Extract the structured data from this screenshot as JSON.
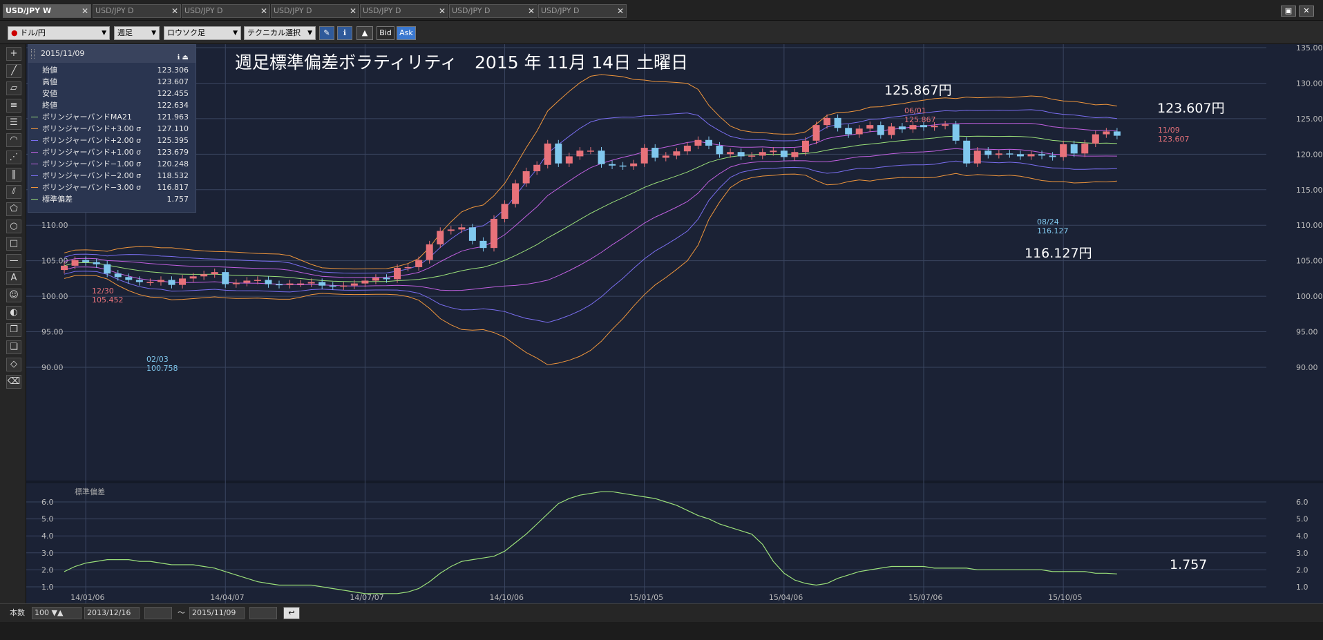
{
  "tabs": [
    {
      "label": "USD/JPY W",
      "active": true
    },
    {
      "label": "USD/JPY D"
    },
    {
      "label": "USD/JPY D"
    },
    {
      "label": "USD/JPY D"
    },
    {
      "label": "USD/JPY D"
    },
    {
      "label": "USD/JPY D"
    },
    {
      "label": "USD/JPY D"
    }
  ],
  "toolbar": {
    "currency": "ドル/円",
    "period": "週足",
    "chart_type": "ロウソク足",
    "technical": "テクニカル選択",
    "bid": "Bid",
    "ask": "Ask"
  },
  "legend": {
    "date": "2015/11/09",
    "rows": [
      {
        "label": "始値",
        "value": "123.306",
        "color": ""
      },
      {
        "label": "高値",
        "value": "123.607",
        "color": ""
      },
      {
        "label": "安値",
        "value": "122.455",
        "color": ""
      },
      {
        "label": "終値",
        "value": "122.634",
        "color": ""
      },
      {
        "label": "ボリンジャーバンドMA21",
        "value": "121.963",
        "color": "#9be07a"
      },
      {
        "label": "ボリンジャーバンド+3.00 σ",
        "value": "127.110",
        "color": "#f0963c"
      },
      {
        "label": "ボリンジャーバンド+2.00 σ",
        "value": "125.395",
        "color": "#7a6ef0"
      },
      {
        "label": "ボリンジャーバンド+1.00 σ",
        "value": "123.679",
        "color": "#c060e0"
      },
      {
        "label": "ボリンジャーバンド−1.00 σ",
        "value": "120.248",
        "color": "#c060e0"
      },
      {
        "label": "ボリンジャーバンド−2.00 σ",
        "value": "118.532",
        "color": "#7a6ef0"
      },
      {
        "label": "ボリンジャーバンド−3.00 σ",
        "value": "116.817",
        "color": "#f0963c"
      },
      {
        "label": "標準偏差",
        "value": "1.757",
        "color": "#9be07a"
      }
    ]
  },
  "title": "週足標準偏差ボラティリティ　2015 年 11月 14日 土曜日",
  "annotations": {
    "high_big": "125.867円",
    "last_big": "123.607円",
    "low_big": "116.127円",
    "sd_big": "1.757",
    "mark1_date": "12/30",
    "mark1_val": "105.452",
    "mark2_date": "02/03",
    "mark2_val": "100.758",
    "mark3_date": "06/01",
    "mark3_val": "125.867",
    "mark4_date": "08/24",
    "mark4_val": "116.127",
    "mark5_date": "11/09",
    "mark5_val": "123.607"
  },
  "sub_label": "標準偏差",
  "bottom": {
    "count_label": "本数",
    "count": "100",
    "from": "2013/12/16",
    "tilde": "～",
    "to": "2015/11/09"
  },
  "colors": {
    "bg": "#1b2235",
    "up": "#e8727a",
    "down": "#80c8ee",
    "grid": "#3a4560",
    "ma": "#9be07a",
    "s1": "#c060e0",
    "s2": "#7a6ef0",
    "s3": "#f0963c",
    "sd": "#9be07a"
  },
  "chart_data": {
    "type": "candlestick",
    "ylim": [
      88,
      135
    ],
    "yticks": [
      "135.00",
      "130.00",
      "125.00",
      "120.00",
      "115.00",
      "110.00",
      "105.00",
      "100.00",
      "95.00",
      "90.00"
    ],
    "xticks": [
      "14/01/06",
      "14/04/07",
      "14/07/07",
      "14/10/06",
      "15/01/05",
      "15/04/06",
      "15/07/06",
      "15/10/05"
    ],
    "close": [
      104.3,
      105.1,
      104.8,
      104.5,
      103.2,
      102.7,
      102.3,
      102.0,
      102.0,
      102.3,
      101.6,
      102.5,
      102.8,
      103.1,
      103.4,
      101.7,
      101.9,
      102.2,
      102.3,
      101.7,
      101.6,
      101.8,
      101.8,
      102.0,
      101.5,
      101.4,
      101.5,
      101.8,
      102.2,
      102.6,
      102.4,
      104.0,
      104.1,
      105.1,
      107.3,
      109.2,
      109.4,
      109.7,
      107.8,
      106.8,
      110.9,
      113.0,
      115.9,
      117.6,
      118.5,
      121.5,
      118.7,
      119.7,
      120.5,
      120.5,
      118.6,
      118.4,
      118.3,
      118.7,
      120.9,
      119.5,
      119.8,
      120.4,
      121.2,
      122.0,
      121.2,
      120.0,
      120.3,
      119.7,
      119.8,
      120.3,
      120.5,
      119.6,
      120.3,
      121.9,
      124.1,
      125.1,
      123.7,
      122.8,
      123.6,
      124.1,
      122.7,
      123.9,
      123.5,
      124.1,
      123.8,
      124.0,
      124.2,
      121.9,
      118.7,
      120.5,
      119.9,
      120.1,
      120.0,
      119.7,
      120.0,
      119.8,
      119.6,
      121.4,
      120.1,
      121.5,
      122.8,
      123.2,
      122.6
    ],
    "sd": [
      1.9,
      2.2,
      2.4,
      2.5,
      2.6,
      2.6,
      2.6,
      2.5,
      2.5,
      2.4,
      2.3,
      2.3,
      2.3,
      2.2,
      2.1,
      1.9,
      1.7,
      1.5,
      1.3,
      1.2,
      1.1,
      1.1,
      1.1,
      1.1,
      1.0,
      0.9,
      0.8,
      0.7,
      0.6,
      0.6,
      0.6,
      0.6,
      0.7,
      0.9,
      1.3,
      1.8,
      2.2,
      2.5,
      2.6,
      2.7,
      2.8,
      3.1,
      3.6,
      4.1,
      4.7,
      5.3,
      5.9,
      6.2,
      6.4,
      6.5,
      6.6,
      6.6,
      6.5,
      6.4,
      6.3,
      6.2,
      6.0,
      5.8,
      5.5,
      5.2,
      5.0,
      4.7,
      4.5,
      4.3,
      4.1,
      3.5,
      2.5,
      1.8,
      1.4,
      1.2,
      1.1,
      1.2,
      1.5,
      1.7,
      1.9,
      2.0,
      2.1,
      2.2,
      2.2,
      2.2,
      2.2,
      2.1,
      2.1,
      2.1,
      2.1,
      2.0,
      2.0,
      2.0,
      2.0,
      2.0,
      2.0,
      2.0,
      1.9,
      1.9,
      1.9,
      1.9,
      1.8,
      1.8,
      1.76
    ],
    "sd_ylim": [
      0.5,
      6.8
    ],
    "sd_yticks": [
      "6.0",
      "5.0",
      "4.0",
      "3.0",
      "2.0",
      "1.0"
    ]
  }
}
